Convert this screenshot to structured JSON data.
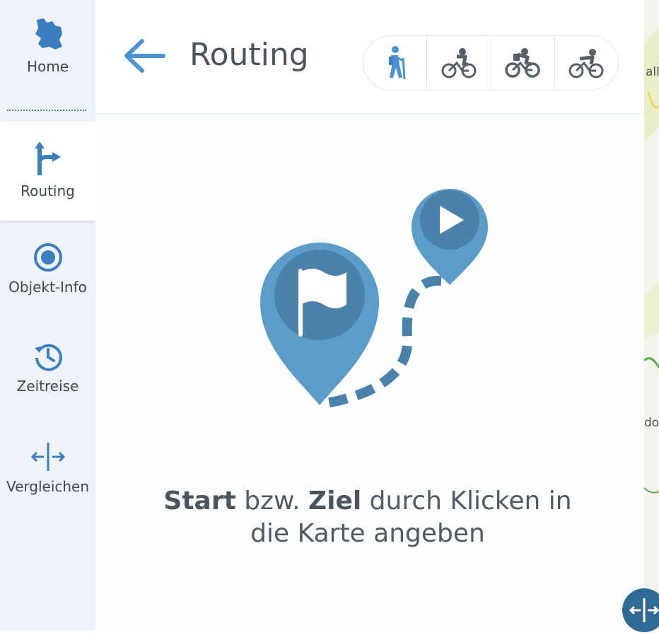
{
  "sidebar": {
    "items": [
      {
        "label": "Home",
        "icon": "bavaria-map-icon"
      },
      {
        "label": "Routing",
        "icon": "route-fork-icon"
      },
      {
        "label": "Objekt-Info",
        "icon": "target-icon"
      },
      {
        "label": "Zeitreise",
        "icon": "history-icon"
      },
      {
        "label": "Vergleichen",
        "icon": "compare-icon"
      }
    ]
  },
  "header": {
    "title": "Routing",
    "modes": [
      {
        "icon": "hiking-icon",
        "active": true
      },
      {
        "icon": "city-bike-icon"
      },
      {
        "icon": "mountain-bike-icon"
      },
      {
        "icon": "racing-bike-icon"
      }
    ]
  },
  "hint": {
    "start": "Start",
    "or": " bzw. ",
    "ziel": "Ziel",
    "rest": " durch Klicken in die Karte angeben"
  },
  "map": {
    "label_top": "alle",
    "label_mid": "do"
  },
  "colors": {
    "accent": "#4a94d6",
    "pin": "#5b9cc9",
    "pin_dark": "#4a82ab",
    "text": "#4a5560"
  }
}
